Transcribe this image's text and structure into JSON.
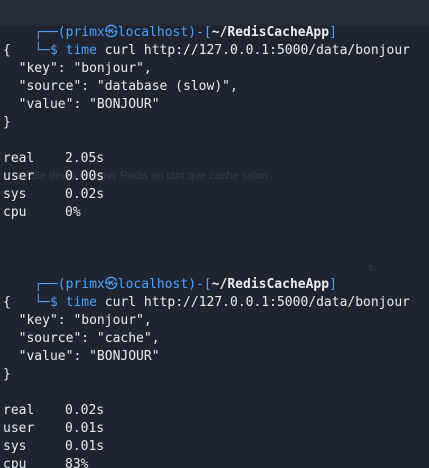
{
  "window": {
    "prompt_user_host": "primx㉿localhost",
    "prompt_path": "~/RedisCacheApp"
  },
  "sessions": [
    {
      "command": {
        "time": "time",
        "curl": "curl",
        "url": "http://127.0.0.1:5000/data/bonjour"
      },
      "json": {
        "open": "{",
        "key_line": "  \"key\": \"bonjour\",",
        "source_line": "  \"source\": \"database (slow)\",",
        "value_line": "  \"value\": \"BONJOUR\"",
        "close": "}"
      },
      "stats": [
        {
          "label": "real",
          "value": "2.05s"
        },
        {
          "label": "user",
          "value": "0.00s"
        },
        {
          "label": "sys",
          "value": "0.02s"
        },
        {
          "label": "cpu",
          "value": "0%"
        }
      ]
    },
    {
      "command": {
        "time": "time",
        "curl": "curl",
        "url": "http://127.0.0.1:5000/data/bonjour"
      },
      "json": {
        "open": "{",
        "key_line": "  \"key\": \"bonjour\",",
        "source_line": "  \"source\": \"cache\",",
        "value_line": "  \"value\": \"BONJOUR\"",
        "close": "}"
      },
      "stats": [
        {
          "label": "real",
          "value": "0.02s"
        },
        {
          "label": "user",
          "value": "0.01s"
        },
        {
          "label": "sys",
          "value": "0.01s"
        },
        {
          "label": "cpu",
          "value": "83%"
        }
      ]
    }
  ],
  "background_text": {
    "line1": "s. Elle devra intégrer Redis en tant que cache selon",
    "line2": "s."
  },
  "colors": {
    "background": "#1f2430",
    "accent": "#4aa3ff",
    "text": "#e9edf1"
  }
}
